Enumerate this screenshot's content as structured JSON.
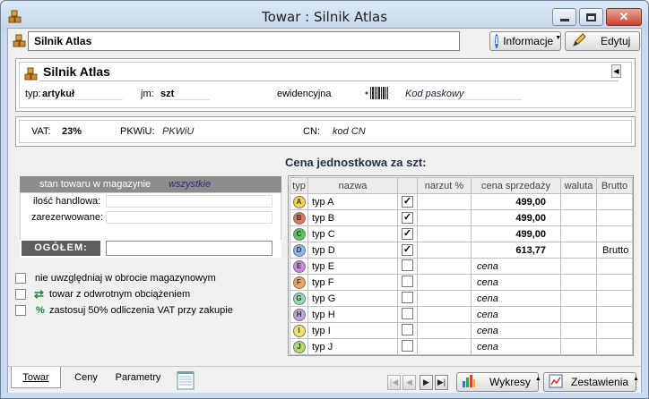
{
  "window": {
    "title": "Towar : Silnik Atlas"
  },
  "toolbar": {
    "name_value": "Silnik Atlas",
    "info_label": "Informacje",
    "edit_label": "Edytuj"
  },
  "header": {
    "product_name": "Silnik Atlas",
    "typ_label": "typ:",
    "typ_value": "artykuł",
    "jm_label": "jm:",
    "jm_value": "szt",
    "ewid_label": "ewidencyjna",
    "barcode_label": "Kod paskowy"
  },
  "tax": {
    "vat_label": "VAT:",
    "vat_value": "23%",
    "pkwiu_label": "PKWiU:",
    "pkwiu_value": "PKWiU",
    "cn_label": "CN:",
    "cn_value": "kod CN"
  },
  "stock": {
    "header_label": "stan towaru w magazynie",
    "filter_value": "wszystkie",
    "handlowa_label": "ilość handlowa:",
    "zarezerwowane_label": "zarezerwowane:",
    "ogolem_label": "OGÓŁEM:"
  },
  "options": [
    {
      "label": "nie uwzględniaj w obrocie magazynowym",
      "icon": ""
    },
    {
      "label": "towar z odwrotnym obciążeniem",
      "icon": "reverse-arrows-icon"
    },
    {
      "label": "zastosuj 50% odliczenia VAT przy zakupie",
      "icon": "percent-icon"
    }
  ],
  "prices": {
    "title": "Cena jednostkowa za szt:",
    "columns": [
      "typ",
      "nazwa",
      "",
      "narzut %",
      "cena sprzedaży",
      "waluta",
      "Brutto"
    ],
    "rows": [
      {
        "letter": "A",
        "color": "#f2d64b",
        "name": "typ A",
        "checked": true,
        "price": "499,00",
        "brutto": ""
      },
      {
        "letter": "B",
        "color": "#e0735a",
        "name": "typ B",
        "checked": true,
        "price": "499,00",
        "brutto": ""
      },
      {
        "letter": "C",
        "color": "#5cc45a",
        "name": "typ C",
        "checked": true,
        "price": "499,00",
        "brutto": ""
      },
      {
        "letter": "D",
        "color": "#8fb6e8",
        "name": "typ D",
        "checked": true,
        "price": "613,77",
        "brutto": "Brutto"
      },
      {
        "letter": "E",
        "color": "#c68be0",
        "name": "typ E",
        "checked": false,
        "price": "cena",
        "brutto": ""
      },
      {
        "letter": "F",
        "color": "#eca565",
        "name": "typ F",
        "checked": false,
        "price": "cena",
        "brutto": ""
      },
      {
        "letter": "G",
        "color": "#9ad9b8",
        "name": "typ G",
        "checked": false,
        "price": "cena",
        "brutto": ""
      },
      {
        "letter": "H",
        "color": "#b9a7d6",
        "name": "typ H",
        "checked": false,
        "price": "cena",
        "brutto": ""
      },
      {
        "letter": "I",
        "color": "#f3e46a",
        "name": "typ I",
        "checked": false,
        "price": "cena",
        "brutto": ""
      },
      {
        "letter": "J",
        "color": "#b4db6a",
        "name": "typ J",
        "checked": false,
        "price": "cena",
        "brutto": ""
      }
    ]
  },
  "tabs": {
    "towar": "Towar",
    "ceny": "Ceny",
    "parametry": "Parametry"
  },
  "bottom": {
    "wykresy_label": "Wykresy",
    "zestawienia_label": "Zestawienia"
  }
}
